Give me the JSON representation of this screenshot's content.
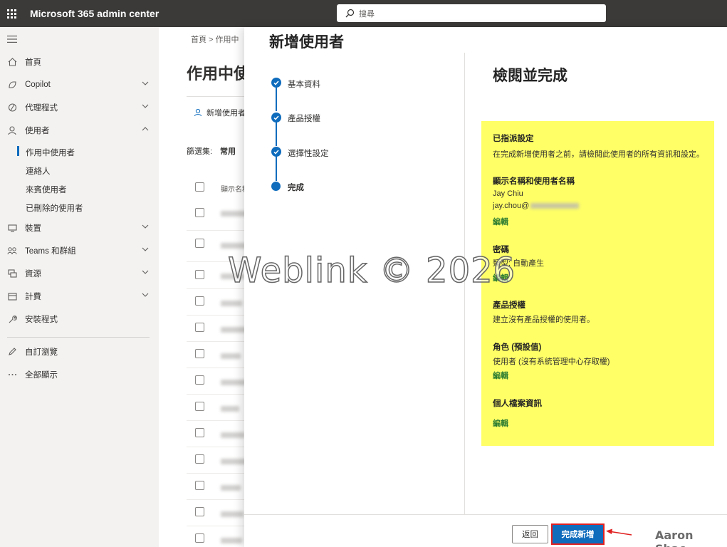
{
  "topbar": {
    "app_title": "Microsoft 365 admin center",
    "search_placeholder": "搜尋"
  },
  "nav": {
    "items": [
      {
        "label": "首頁",
        "icon": "home-icon"
      },
      {
        "label": "Copilot",
        "icon": "copilot-icon"
      },
      {
        "label": "代理程式",
        "icon": "agent-icon"
      },
      {
        "label": "使用者",
        "icon": "user-icon"
      },
      {
        "label": "裝置",
        "icon": "device-icon"
      },
      {
        "label": "Teams 和群組",
        "icon": "teams-icon"
      },
      {
        "label": "資源",
        "icon": "resources-icon"
      },
      {
        "label": "計費",
        "icon": "billing-icon"
      },
      {
        "label": "安裝程式",
        "icon": "wrench-icon"
      },
      {
        "label": "自訂瀏覽",
        "icon": "pencil-icon"
      },
      {
        "label": "全部顯示",
        "icon": "more-icon"
      }
    ],
    "users_sub": [
      "作用中使用者",
      "連絡人",
      "來賓使用者",
      "已刪除的使用者"
    ]
  },
  "page": {
    "breadcrumb": "首頁  >  作用中",
    "heading": "作用中使",
    "add_user_label": "新增使用者",
    "filter_label": "篩選集:",
    "filter_value": "常用",
    "col_display_name": "顯示名稱"
  },
  "panel": {
    "title": "新增使用者",
    "steps": [
      "基本資料",
      "產品授權",
      "選擇性設定",
      "完成"
    ],
    "review_title": "檢閱並完成",
    "assigned_heading": "已指派設定",
    "assigned_desc": "在完成新增使用者之前，請檢閱此使用者的所有資訊和設定。",
    "name_heading": "顯示名稱和使用者名稱",
    "display_name": "Jay Chiu",
    "email_prefix": "jay.chou@",
    "edit_label": "編輯",
    "password_heading": "密碼",
    "password_type": "類型: 自動產生",
    "license_heading": "產品授權",
    "license_desc": "建立沒有產品授權的使用者。",
    "role_heading": "角色 (預設值)",
    "role_desc": "使用者 (沒有系統管理中心存取權)",
    "profile_heading": "個人檔案資訊",
    "back_button": "返回",
    "finish_button": "完成新增"
  },
  "watermark": "Weblink © 2026",
  "signature": "Aaron Shao",
  "colors": {
    "accent": "#0f6cbd",
    "highlight": "#ffff66",
    "link_green": "#2e7d32",
    "topbar": "#3b3a39"
  }
}
